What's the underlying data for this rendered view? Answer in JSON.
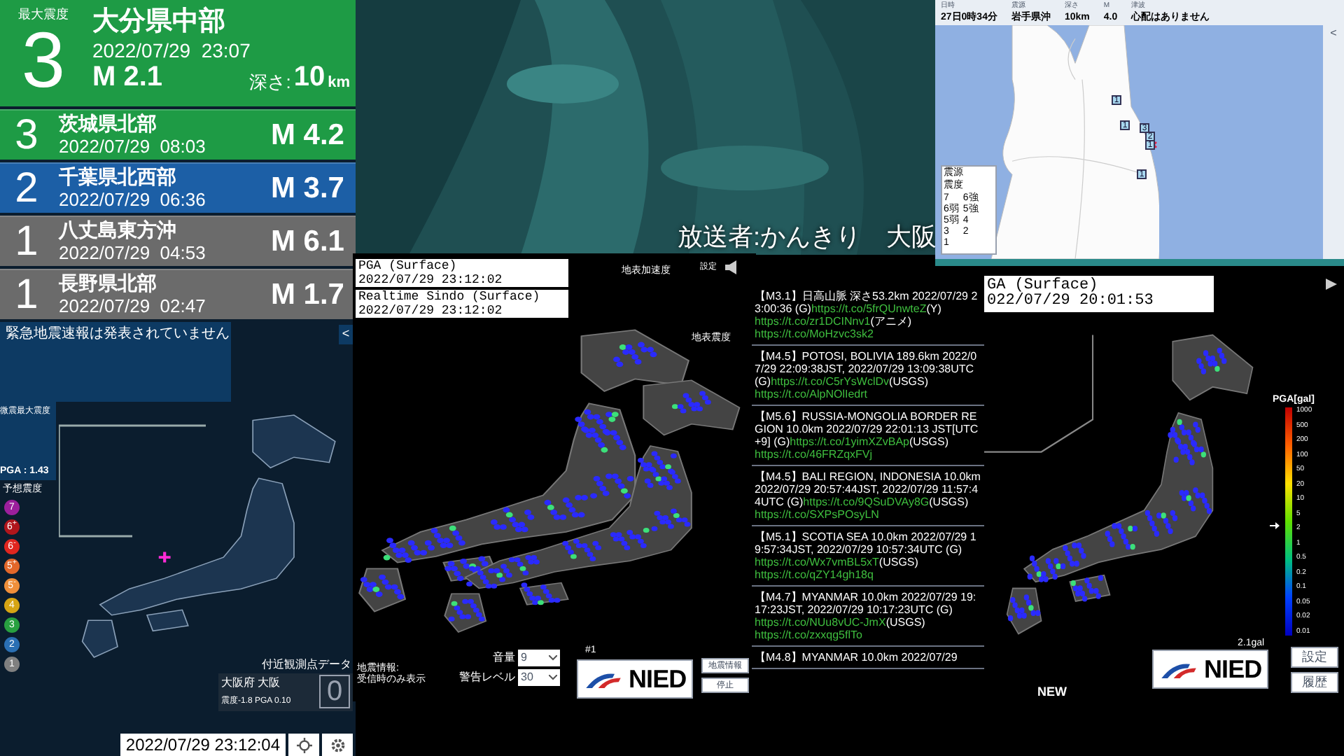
{
  "quake_panel": {
    "max_label": "最大震度",
    "latest": {
      "intensity": "3",
      "region": "大分県中部",
      "datetime": "2022/07/29  23:07",
      "magnitude": "M 2.1",
      "depth_label": "深さ:",
      "depth": "10",
      "depth_unit": "km",
      "color": "#1e9b45"
    },
    "history": [
      {
        "intensity": "3",
        "region": "茨城県北部",
        "datetime": "2022/07/29  08:03",
        "magnitude": "M 4.2",
        "color": "#1e9b45"
      },
      {
        "intensity": "2",
        "region": "千葉県北西部",
        "datetime": "2022/07/29  06:36",
        "magnitude": "M 3.7",
        "color": "#1c5fa6"
      },
      {
        "intensity": "1",
        "region": "八丈島東方沖",
        "datetime": "2022/07/29  04:53",
        "magnitude": "M 6.1",
        "color": "#6b6b6b"
      },
      {
        "intensity": "1",
        "region": "長野県北部",
        "datetime": "2022/07/29  02:47",
        "magnitude": "M 1.7",
        "color": "#6b6b6b"
      }
    ],
    "warning": "緊急地震速報は発表されていません",
    "collapse": "<"
  },
  "left_map": {
    "max_label": "微震最大震度",
    "pga": "PGA : 1.43",
    "scale_title": "予想震度",
    "scale": [
      {
        "label": "7",
        "color": "#9c1f9c"
      },
      {
        "label": "6$^{+}$",
        "color": "#b0161c"
      },
      {
        "label": "6$^{-}$",
        "color": "#e0261f"
      },
      {
        "label": "5$^{+}$",
        "color": "#e2672a"
      },
      {
        "label": "5$^{-}$",
        "color": "#ef8f3a"
      },
      {
        "label": "4",
        "color": "#d6a514"
      },
      {
        "label": "3",
        "color": "#28a040"
      },
      {
        "label": "2",
        "color": "#2a6fb3"
      },
      {
        "label": "1",
        "color": "#808080"
      }
    ],
    "nearby": {
      "title": "付近観測点データ",
      "station": "大阪府 大阪",
      "detail": "震度-1.8  PGA 0.10",
      "intensity": "0"
    },
    "clock": "2022/07/29 23:12:04"
  },
  "broadcaster": "放送者:かんきり　大阪",
  "info_map": {
    "header": [
      {
        "label": "日時",
        "value": "27日0時34分"
      },
      {
        "label": "震源",
        "value": "岩手県沖"
      },
      {
        "label": "深さ",
        "value": "10km"
      },
      {
        "label": "M",
        "value": "4.0"
      },
      {
        "label": "津波",
        "value": "心配はありません"
      }
    ],
    "collapse": "<",
    "markers": [
      "1",
      "1",
      "3",
      "2",
      "1",
      "1"
    ],
    "legend_title": "震源",
    "legend_sub": "震度",
    "legend": [
      "7",
      "6強",
      "6弱",
      "5強",
      "5弱",
      "4",
      "3",
      "2",
      "1"
    ]
  },
  "kyoshin": {
    "boxes": [
      {
        "title": "PGA (Surface)",
        "time": "2022/07/29 23:12:02"
      },
      {
        "title": "Realtime Sindo (Surface)",
        "time": "2022/07/29 23:12:02"
      }
    ],
    "label_top": "地表加速度",
    "label_bottom": "地表震度",
    "settings": "設定",
    "note": [
      "地震情報:",
      "受信時のみ表示"
    ],
    "volume_label": "音量",
    "volume": "9",
    "alert_label": "警告レベル",
    "alert": "30",
    "channel": "#1",
    "logo": "NIED",
    "buttons": [
      "地震情報",
      "停止"
    ]
  },
  "feed": [
    [
      {
        "kind": "text",
        "text": "【M3.1】日高山脈 深さ53.2km 2022/07/29 23:00:36 (G)"
      },
      {
        "kind": "link",
        "text": "https://t.co/5frQUnwteZ"
      },
      {
        "kind": "text",
        "text": "(Y)"
      },
      {
        "kind": "link",
        "text": "https://t.co/zr1DCINnv1"
      },
      {
        "kind": "text",
        "text": "(アニメ)"
      },
      {
        "kind": "link",
        "text": "https://t.co/MoHzvc3sk2"
      }
    ],
    [
      {
        "kind": "text",
        "text": "【M4.5】POTOSI, BOLIVIA 189.6km 2022/07/29 22:09:38JST, 2022/07/29 13:09:38UTC (G)"
      },
      {
        "kind": "link",
        "text": "https://t.co/C5rYsWclDv"
      },
      {
        "kind": "text",
        "text": "(USGS)"
      },
      {
        "kind": "link",
        "text": "https://t.co/AlpNOlIedrt"
      }
    ],
    [
      {
        "kind": "text",
        "text": "【M5.6】RUSSIA-MONGOLIA BORDER REGION 10.0km 2022/07/29 22:01:13 JST[UTC+9] (G)"
      },
      {
        "kind": "link",
        "text": "https://t.co/1yimXZvBAp"
      },
      {
        "kind": "text",
        "text": "(USGS)"
      },
      {
        "kind": "link",
        "text": "https://t.co/46FRZqxFVj"
      }
    ],
    [
      {
        "kind": "text",
        "text": "【M4.5】BALI REGION, INDONESIA 10.0km 2022/07/29 20:57:44JST, 2022/07/29 11:57:44UTC (G)"
      },
      {
        "kind": "link",
        "text": "https://t.co/9QSuDVAy8G"
      },
      {
        "kind": "text",
        "text": "(USGS)"
      },
      {
        "kind": "link",
        "text": "https://t.co/SXPsPOsyLN"
      }
    ],
    [
      {
        "kind": "text",
        "text": "【M5.1】SCOTIA SEA 10.0km 2022/07/29 19:57:34JST, 2022/07/29 10:57:34UTC (G)"
      },
      {
        "kind": "link",
        "text": "https://t.co/Wx7vmBL5xT"
      },
      {
        "kind": "text",
        "text": "(USGS)"
      },
      {
        "kind": "link",
        "text": "https://t.co/qZY14gh18q"
      }
    ],
    [
      {
        "kind": "text",
        "text": "【M4.7】MYANMAR 10.0km 2022/07/29 19:17:23JST, 2022/07/29 10:17:23UTC (G)"
      },
      {
        "kind": "link",
        "text": "https://t.co/NUu8vUC-JmX"
      },
      {
        "kind": "text",
        "text": "(USGS)"
      },
      {
        "kind": "link",
        "text": "https://t.co/zxxqg5flTo"
      }
    ],
    [
      {
        "kind": "text",
        "text": "【M4.8】MYANMAR 10.0km 2022/07/29"
      }
    ]
  ],
  "kyoshin_right": {
    "title": "GA (Surface)",
    "time": "022/07/29 20:01:53",
    "scale_title": "PGA[gal]",
    "scale": [
      "1000",
      "500",
      "200",
      "100",
      "50",
      "20",
      "10",
      "5",
      "2",
      "1",
      "0.5",
      "0.2",
      "0.1",
      "0.05",
      "0.02",
      "0.01"
    ],
    "level": 0.5,
    "reading": "2.1gal",
    "logo": "NIED",
    "new": "NEW",
    "buttons": [
      "設定",
      "履歴"
    ]
  }
}
